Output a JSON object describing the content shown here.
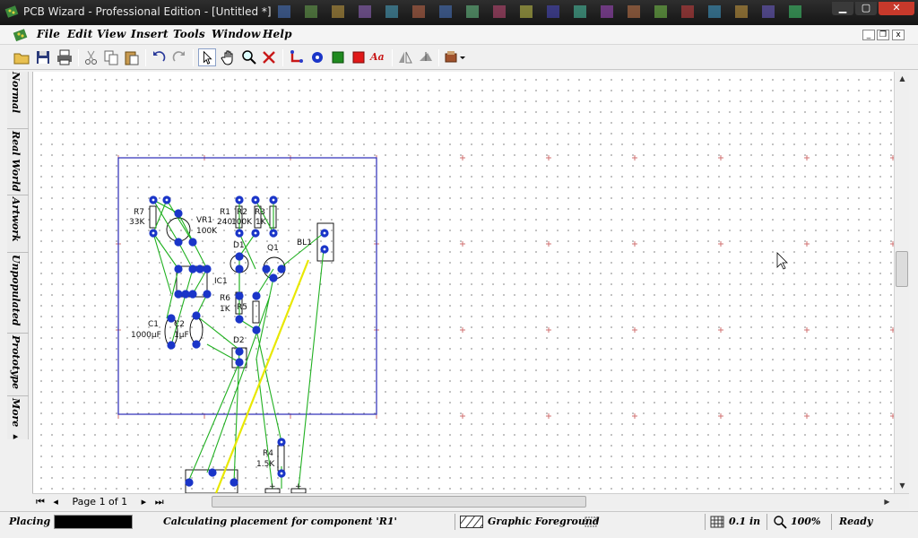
{
  "window": {
    "title": "PCB Wizard - Professional Edition - [Untitled *]",
    "minimize_label": "▁",
    "maximize_label": "▢",
    "close_label": "✕"
  },
  "menu": {
    "items": [
      "File",
      "Edit",
      "View",
      "Insert",
      "Tools",
      "Window",
      "Help"
    ],
    "mdi_minimize": "_",
    "mdi_restore": "❐",
    "mdi_close": "x"
  },
  "toolbar": {
    "text_tool_label": "Aa"
  },
  "side_tabs": [
    "Normal",
    "Real World",
    "Artwork",
    "Unpopulated",
    "Prototype",
    "More ▸"
  ],
  "canvas": {
    "components": {
      "r7_name": "R7",
      "r7_value": "33K",
      "vr1_name": "VR1",
      "vr1_value": "100K",
      "r1_name": "R1",
      "r1_value": "240",
      "r2_name": "R2",
      "r2_value": "100K",
      "r3_name": "R3",
      "r3_value": "1K",
      "d1_name": "D1",
      "q1_name": "Q1",
      "bl1_name": "BL1",
      "ic1_name": "IC1",
      "r6_name": "R6",
      "r6_value": "1K",
      "r5_name": "R5",
      "c1_name": "C1",
      "c1_value": "1000µF",
      "c2_name": "C2",
      "c2_value": "1µF",
      "d2_name": "D2",
      "r4_name": "R4",
      "r4_value": "1.5K",
      "plus_sign": "+"
    }
  },
  "pager": {
    "first": "⏮",
    "prev": "◂",
    "page_text": "Page 1 of 1",
    "next": "▸",
    "last": "⏭"
  },
  "status": {
    "mode": "Placing",
    "message": "Calculating placement for component 'R1'",
    "layer": "Graphic Foreground",
    "grid": "0.1 in",
    "zoom": "100%",
    "ready": "Ready"
  },
  "colors": {
    "title_bg": "#1c1c1c",
    "board_outline": "#2a2ab8",
    "pad": "#1a35c8",
    "ratsnest": "#20b020",
    "highlight_track": "#e8e800",
    "close_red": "#c7392b"
  }
}
